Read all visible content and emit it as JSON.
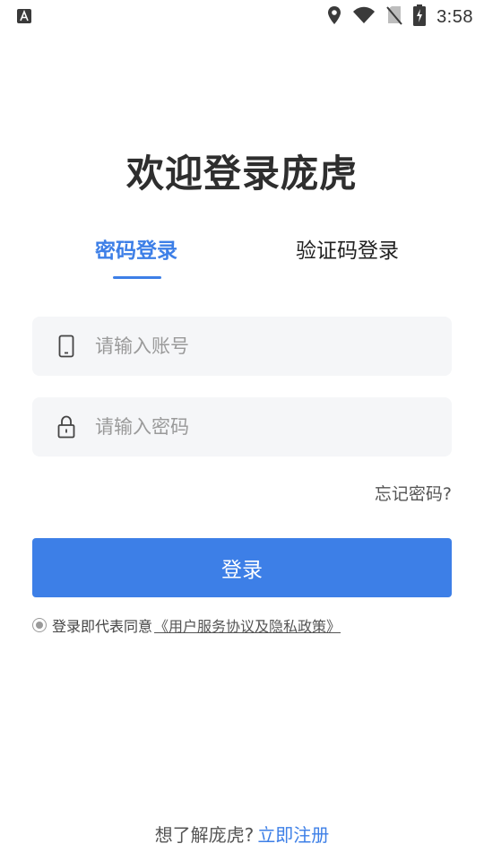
{
  "status_bar": {
    "time": "3:58",
    "icons": [
      "app-notification-icon",
      "location-icon",
      "wifi-icon",
      "no-sim-icon",
      "battery-charging-icon"
    ]
  },
  "title": "欢迎登录庞虎",
  "tabs": [
    {
      "label": "密码登录",
      "active": true
    },
    {
      "label": "验证码登录",
      "active": false
    }
  ],
  "form": {
    "account_placeholder": "请输入账号",
    "password_placeholder": "请输入密码",
    "forgot_label": "忘记密码?",
    "login_label": "登录"
  },
  "agreement": {
    "prefix": "登录即代表同意",
    "link": "《用户服务协议及隐私政策》"
  },
  "footer": {
    "prompt": "想了解庞虎?",
    "register_label": "立即注册"
  },
  "colors": {
    "accent": "#3d7fe7",
    "input_bg": "#f5f6f8",
    "text": "#2e2e2e"
  }
}
